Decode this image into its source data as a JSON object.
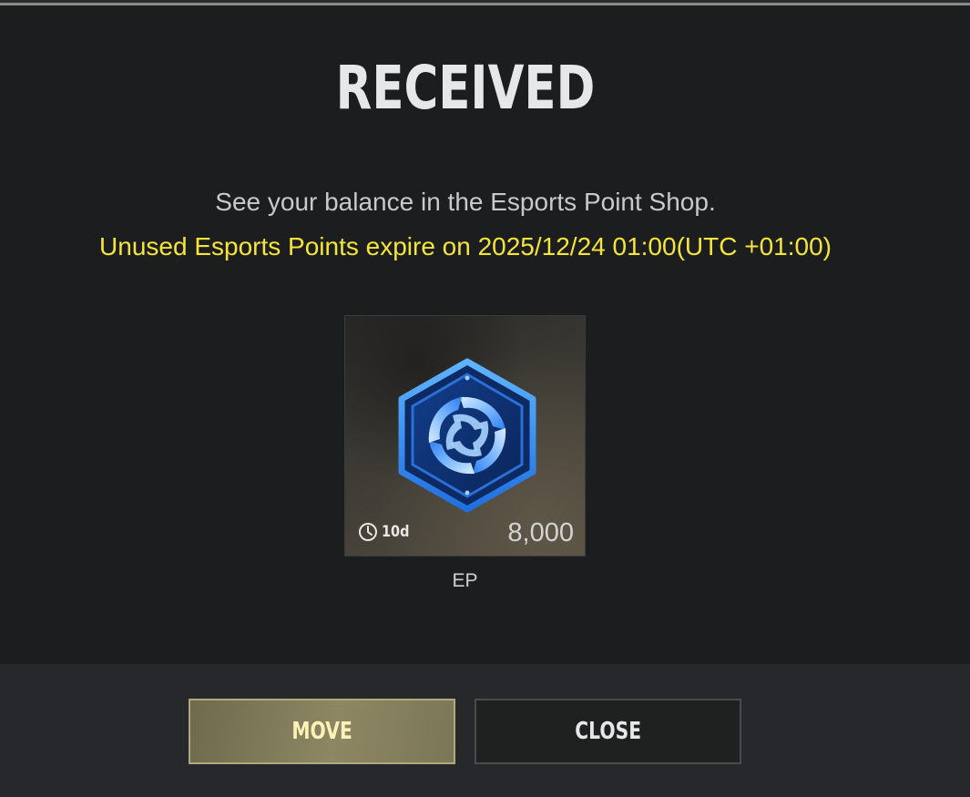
{
  "dialog": {
    "title": "RECEIVED",
    "balance_note": "See your balance in the Esports Point Shop.",
    "expiry_note": "Unused Esports Points expire on 2025/12/24 01:00(UTC +01:00)"
  },
  "item": {
    "icon": "esports-point-emblem",
    "duration": "10d",
    "amount": "8,000",
    "name": "EP"
  },
  "buttons": {
    "move_label": "MOVE",
    "close_label": "CLOSE"
  },
  "colors": {
    "accent_yellow": "#f5e43c",
    "emblem_blue": "#2f8cff",
    "move_button": "#8d8763"
  }
}
